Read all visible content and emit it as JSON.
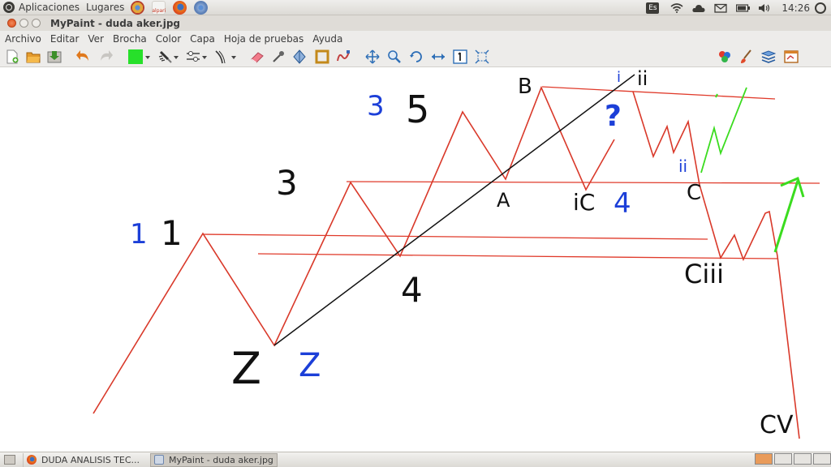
{
  "panel": {
    "menu_apps": "Aplicaciones",
    "menu_places": "Lugares",
    "alpari_label": "alpari",
    "keyboard_layout": "Es",
    "time": "14:26"
  },
  "window": {
    "title": "MyPaint - duda aker.jpg"
  },
  "menubar": {
    "items": [
      "Archivo",
      "Editar",
      "Ver",
      "Brocha",
      "Color",
      "Capa",
      "Hoja de pruebas",
      "Ayuda"
    ]
  },
  "toolbar": {
    "current_color": "#27e02a",
    "icons": [
      "new-file-icon",
      "open-folder-icon",
      "save-icon",
      "undo-icon",
      "redo-icon",
      "color-swatch-icon",
      "brush-icon",
      "adjust-icon",
      "stroke-icon",
      "eraser-icon",
      "picker-icon",
      "symmetry-icon",
      "frame-icon",
      "inking-icon",
      "pan-icon",
      "zoom-icon",
      "rotate-icon",
      "mirror-h-icon",
      "reset-zoom-icon",
      "fit-icon",
      "color-palette-icon",
      "brush-settings-icon",
      "layers-icon",
      "scratchpad-icon"
    ]
  },
  "drawing": {
    "labels": {
      "one_blue": "1",
      "one_black": "1",
      "three_black": "3",
      "three_blue": "3",
      "five_black": "5",
      "two_black": "Z",
      "two_blue": "Z",
      "four": "4",
      "a": "A",
      "b": "B",
      "question": "?",
      "i_blue": "i",
      "ii_black": "ii",
      "ii_blue": "ii",
      "c": "C",
      "ic4_black": "iC",
      "ic4_blue": "4",
      "ciii": "Ciii",
      "cv": "CV"
    },
    "colors": {
      "red": "#e03a2a",
      "black": "#111111",
      "blue": "#1c3fd8",
      "green": "#3bdc1f"
    }
  },
  "taskbar": {
    "tasks": [
      "DUDA ANALISIS TEC...",
      "MyPaint - duda aker.jpg"
    ]
  }
}
